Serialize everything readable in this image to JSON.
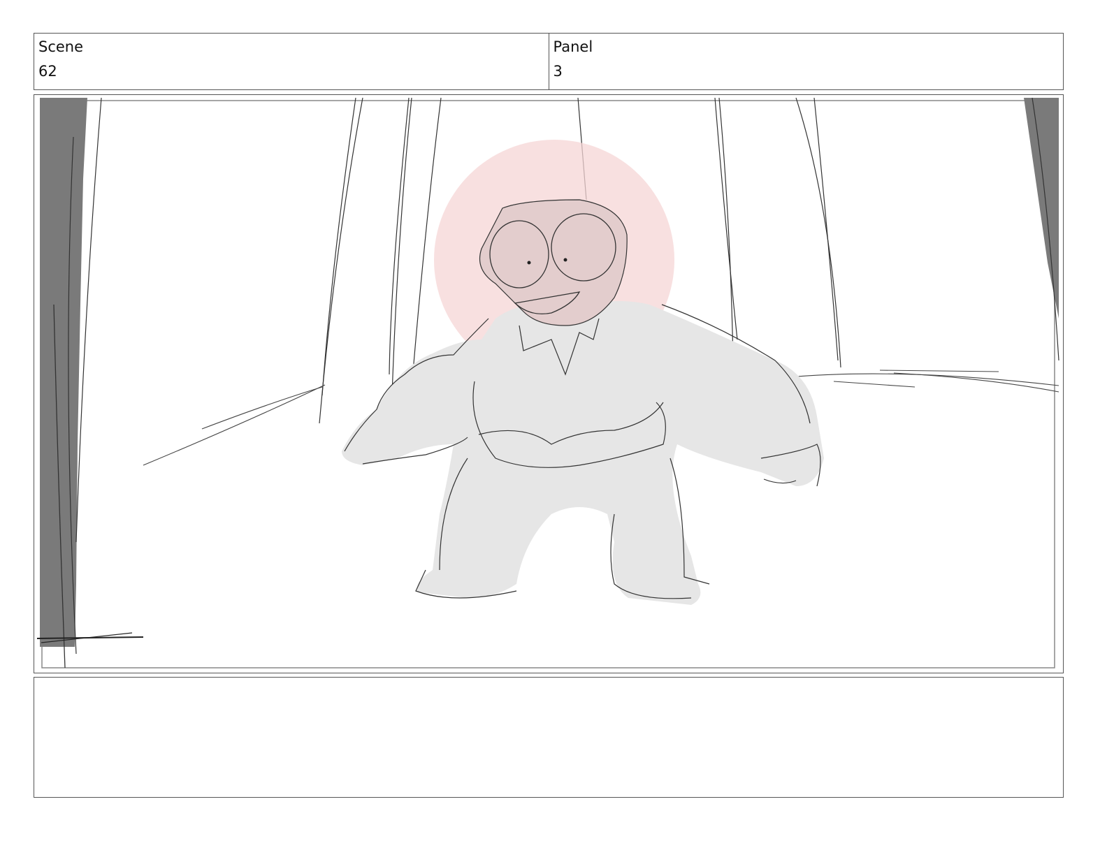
{
  "header": {
    "scene_label": "Scene",
    "scene_value": "62",
    "panel_label": "Panel",
    "panel_value": "3"
  },
  "notes": {
    "text": ""
  },
  "colors": {
    "frame_border": "#555555",
    "curtain_dark": "#7a7a7a",
    "character_fill": "#e6e6e6",
    "highlight_circle": "#f6d6d6",
    "sketch_line": "#3a3a3a"
  }
}
